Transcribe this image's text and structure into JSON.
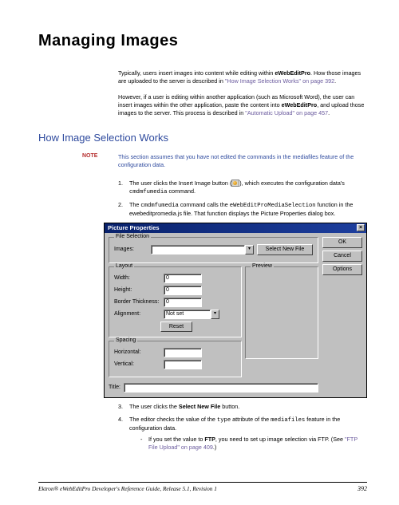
{
  "title": "Managing Images",
  "intro1_a": "Typically, users insert images into content while editing within ",
  "intro1_bold": "eWebEditPro",
  "intro1_b": ". How those images are uploaded to the server is described in ",
  "intro1_link": "\"How Image Selection Works\" on page 392",
  "intro1_c": ".",
  "intro2_a": "However, if a user is editing within another application (such as Microsoft Word), the user can insert images within the other application, paste the content into ",
  "intro2_bold": "eWebEditPro",
  "intro2_b": ", and upload those images to the server. This process is described in ",
  "intro2_link": "\"Automatic Upload\" on page 457",
  "intro2_c": ".",
  "section": "How Image Selection Works",
  "note_label": "Note",
  "note_text": "This section assumes that you have not edited the commands in the mediafiles feature of the configuration data.",
  "step1_num": "1.",
  "step1_a": "The user clicks the Insert Image button (",
  "step1_b": "), which executes the configuration data's ",
  "step1_code": "cmdmfumedia",
  "step1_c": " command.",
  "step2_num": "2.",
  "step2_a": "The ",
  "step2_code1": "cmdmfumedia",
  "step2_b": " command calls the ",
  "step2_code2": "eWebEditProMediaSelection",
  "step2_c": " function in the ewebeditpromedia.js file. That function displays the Picture Properties dialog box.",
  "dialog": {
    "title": "Picture Properties",
    "close": "×",
    "ok": "OK",
    "cancel": "Cancel",
    "options": "Options",
    "file_selection": "File Selection",
    "images_label": "Images:",
    "select_new_file": "Select New File",
    "layout": "Layout",
    "preview": "Preview",
    "width": "Width:",
    "height": "Height:",
    "border": "Border Thickness:",
    "alignment": "Alignment:",
    "notset": "Not set",
    "zero": "0",
    "reset": "Reset",
    "spacing": "Spacing",
    "horizontal": "Horizontal:",
    "vertical": "Vertical:",
    "title_label": "Title:",
    "dropdown_arrow": "▾"
  },
  "step3_num": "3.",
  "step3_a": "The user clicks the ",
  "step3_bold": "Select New File",
  "step3_b": " button.",
  "step4_num": "4.",
  "step4_a": "The editor checks the value of the ",
  "step4_code1": "type",
  "step4_b": " attribute of the ",
  "step4_code2": "mediafiles",
  "step4_c": " feature in the configuration data.",
  "bullet_dash": "-",
  "bullet_a": "If you set the value to ",
  "bullet_bold": "FTP",
  "bullet_b": ", you need to set up image selection via FTP. (See ",
  "bullet_link": "\"FTP File Upload\" on page 409",
  "bullet_c": ".)",
  "footer": "Ektron® eWebEditPro Developer's Reference Guide, Release 5.1, Revision 1",
  "page_num": "392"
}
